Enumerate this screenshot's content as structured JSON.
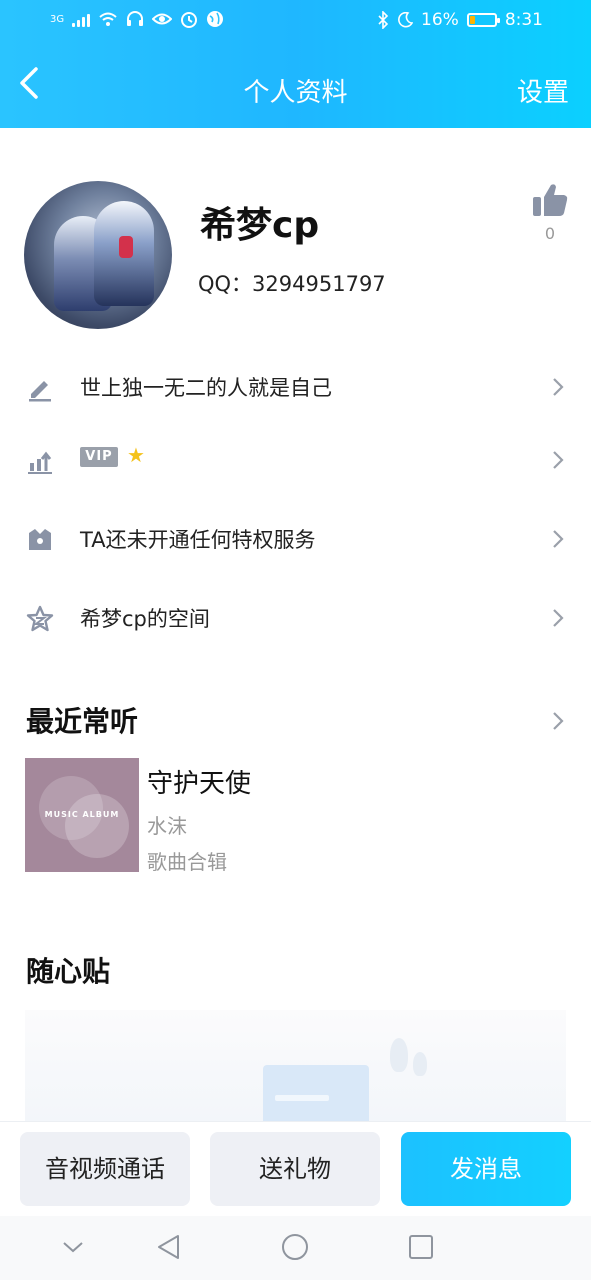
{
  "status_bar": {
    "network": "3G",
    "battery_percent": "16%",
    "time": "8:31",
    "icons": [
      "signal-icon",
      "wifi-icon",
      "headphones-icon",
      "eye-icon",
      "alarm-icon",
      "globe-icon",
      "bluetooth-icon",
      "moon-icon",
      "battery-icon"
    ]
  },
  "header": {
    "title": "个人资料",
    "settings_label": "设置"
  },
  "profile": {
    "name": "希梦cp",
    "qq": "QQ：3294951797",
    "likes": "0"
  },
  "rows": {
    "signature": "世上独一无二的人就是自己",
    "vip_badge": "VIP",
    "privilege": "TA还未开通任何特权服务",
    "space": "希梦cp的空间"
  },
  "recent": {
    "section_title": "最近常听",
    "album_label": "MUSIC ALBUM",
    "song": "守护天使",
    "artist": "水沫",
    "collection": "歌曲合辑"
  },
  "sticky": {
    "section_title": "随心贴"
  },
  "actions": {
    "call": "音视频通话",
    "gift": "送礼物",
    "message": "发消息"
  },
  "colors": {
    "header_gradient_start": "#2ac4ff",
    "header_gradient_end": "#0bd0ff",
    "primary_button": "#13d0ff",
    "secondary_button": "#eef0f5",
    "icon_gray": "#8a93a6"
  }
}
